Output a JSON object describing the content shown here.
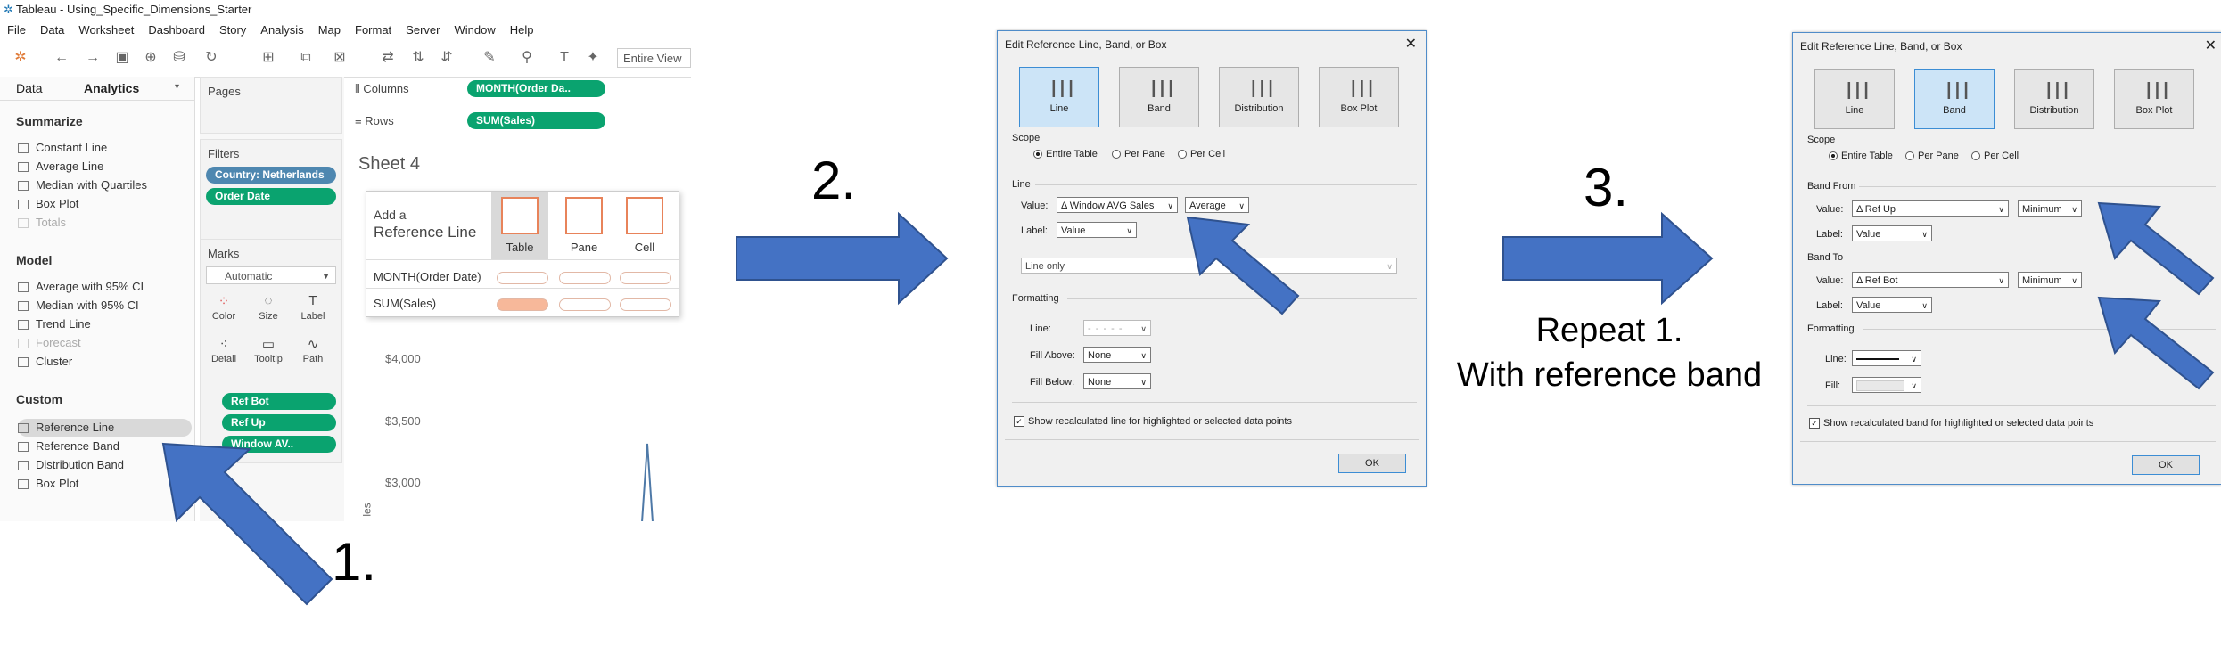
{
  "tableau": {
    "title": "Tableau - Using_Specific_Dimensions_Starter",
    "menu": [
      "File",
      "Data",
      "Worksheet",
      "Dashboard",
      "Story",
      "Analysis",
      "Map",
      "Format",
      "Server",
      "Window",
      "Help"
    ],
    "entire_view": "Entire View",
    "tabs": {
      "data": "Data",
      "analytics": "Analytics"
    },
    "summarize": {
      "heading": "Summarize",
      "items": [
        "Constant Line",
        "Average Line",
        "Median with Quartiles",
        "Box Plot",
        "Totals"
      ]
    },
    "model": {
      "heading": "Model",
      "items": [
        "Average with 95% CI",
        "Median with 95% CI",
        "Trend Line",
        "Forecast",
        "Cluster"
      ]
    },
    "custom": {
      "heading": "Custom",
      "items": [
        "Reference Line",
        "Reference Band",
        "Distribution Band",
        "Box Plot"
      ]
    },
    "pages": "Pages",
    "filters": {
      "heading": "Filters",
      "pills": [
        "Country: Netherlands",
        "Order Date"
      ]
    },
    "marks": {
      "heading": "Marks",
      "type": "Automatic",
      "buttons": [
        "Color",
        "Size",
        "Label",
        "Detail",
        "Tooltip",
        "Path"
      ],
      "pills": [
        "Ref Bot",
        "Ref Up",
        "Window AV.."
      ]
    },
    "columns": {
      "label": "Columns",
      "pill": "MONTH(Order Da.."
    },
    "rows": {
      "label": "Rows",
      "pill": "SUM(Sales)"
    },
    "sheet_title": "Sheet 4",
    "add_ref": {
      "line1": "Add a",
      "line2": "Reference Line",
      "cols": [
        "Table",
        "Pane",
        "Cell"
      ],
      "rows": [
        "MONTH(Order Date)",
        "SUM(Sales)"
      ]
    },
    "yaxis": [
      "$4,000",
      "$3,500",
      "$3,000"
    ],
    "yaxis_label": "les"
  },
  "step1": "1.",
  "step2": "2.",
  "step3": "3.",
  "repeat_caption": {
    "line1": "Repeat 1.",
    "line2": "With reference band"
  },
  "dialog_line": {
    "title": "Edit Reference Line, Band, or Box",
    "types": [
      "Line",
      "Band",
      "Distribution",
      "Box Plot"
    ],
    "scope_label": "Scope",
    "scope_options": [
      "Entire Table",
      "Per Pane",
      "Per Cell"
    ],
    "line_label": "Line",
    "value_label": "Value:",
    "value": "Window AVG Sales",
    "agg": "Average",
    "label_label": "Label:",
    "label_value": "Value",
    "tooltip_value": "Line only",
    "formatting_label": "Formatting",
    "line_fmt": "Line:",
    "fill_above": "Fill Above:",
    "fill_above_value": "None",
    "fill_below": "Fill Below:",
    "fill_below_value": "None",
    "checkbox": "Show recalculated line for highlighted or selected data points",
    "ok": "OK"
  },
  "dialog_band": {
    "title": "Edit Reference Line, Band, or Box",
    "types": [
      "Line",
      "Band",
      "Distribution",
      "Box Plot"
    ],
    "scope_label": "Scope",
    "scope_options": [
      "Entire Table",
      "Per Pane",
      "Per Cell"
    ],
    "band_from": "Band From",
    "band_to": "Band To",
    "value_label": "Value:",
    "from_value": "Ref Up",
    "from_agg": "Minimum",
    "to_value": "Ref Bot",
    "to_agg": "Minimum",
    "label_label": "Label:",
    "label_value": "Value",
    "formatting_label": "Formatting",
    "line_fmt": "Line:",
    "fill_fmt": "Fill:",
    "checkbox": "Show recalculated band for highlighted or selected data points",
    "ok": "OK"
  },
  "colors": {
    "arrow": "#4472c4",
    "arrow_edge": "#2f528f",
    "green_pill": "#0aa36f",
    "blue_pill": "#4e87b0"
  }
}
